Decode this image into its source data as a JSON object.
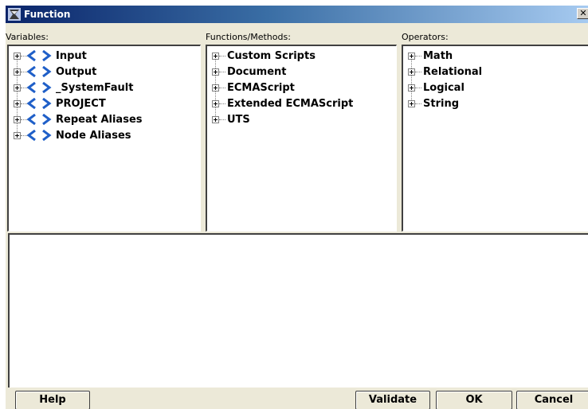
{
  "window": {
    "title": "Function",
    "close_glyph": "✕"
  },
  "variables": {
    "label": "Variables:",
    "items": [
      {
        "label": "Input"
      },
      {
        "label": "Output"
      },
      {
        "label": "_SystemFault"
      },
      {
        "label": "PROJECT"
      },
      {
        "label": "Repeat Aliases"
      },
      {
        "label": "Node Aliases"
      }
    ]
  },
  "functions": {
    "label": "Functions/Methods:",
    "items": [
      {
        "label": "Custom Scripts"
      },
      {
        "label": "Document"
      },
      {
        "label": "ECMAScript"
      },
      {
        "label": "Extended ECMAScript"
      },
      {
        "label": "UTS"
      }
    ]
  },
  "operators": {
    "label": "Operators:",
    "items": [
      {
        "label": "Math"
      },
      {
        "label": "Relational"
      },
      {
        "label": "Logical"
      },
      {
        "label": "String"
      }
    ]
  },
  "editor": {
    "value": ""
  },
  "buttons": {
    "help": "Help",
    "validate": "Validate",
    "ok": "OK",
    "cancel": "Cancel"
  },
  "colors": {
    "titlebar_start": "#0a246a",
    "titlebar_end": "#a6caf0",
    "variable_icon": "#1f5fc8",
    "dialog_bg": "#ece9d8"
  },
  "icons": {
    "title": "function-icon",
    "variable": "angle-brackets-icon",
    "expander": "plus-box-icon"
  }
}
